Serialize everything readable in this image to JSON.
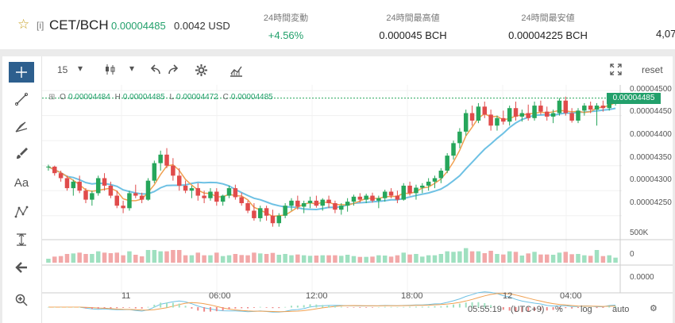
{
  "ticker": {
    "tag": "[i]",
    "pair": "CET/BCH",
    "price": "0.00004485",
    "usd": "0.0042 USD",
    "stats": [
      {
        "label": "24時間変動",
        "value": "+4.56%"
      },
      {
        "label": "24時間最高値",
        "value": "0.000045 BCH"
      },
      {
        "label": "24時間最安値",
        "value": "0.00004225 BCH"
      }
    ],
    "truncated": "4,07"
  },
  "toolbar": {
    "interval": "15",
    "reset": "reset"
  },
  "ohlc": {
    "o_label": "O",
    "o": "0.00004484",
    "h_label": "H",
    "h": "0.00004485",
    "l_label": "L",
    "l": "0.00004472",
    "c_label": "C",
    "c": "0.00004485"
  },
  "price_label": "0.00004485",
  "y_axis": [
    "0.00004500",
    "0.00004450",
    "0.00004400",
    "0.00004350",
    "0.00004300",
    "0.00004250"
  ],
  "volume_axis": [
    "500K",
    "0"
  ],
  "macd_axis": [
    "0.0000"
  ],
  "x_axis": [
    "11",
    "06:00",
    "12:00",
    "18:00",
    "12",
    "04:00"
  ],
  "bottom": {
    "time": "05:55:19",
    "tz": "(UTC+9)",
    "percent": "%",
    "log": "log",
    "auto": "auto"
  },
  "colors": {
    "up": "#26a65b",
    "down": "#e04b4b",
    "ma_fast": "#f0a050",
    "ma_slow": "#6ec1e4",
    "accent": "#2d5f8e"
  },
  "chart_data": {
    "type": "candlestick",
    "y_range": [
      4.21e-05,
      4.505e-05
    ],
    "candles": [
      [
        4347,
        4352,
        4340,
        4348
      ],
      [
        4348,
        4350,
        4330,
        4335
      ],
      [
        4335,
        4340,
        4318,
        4325
      ],
      [
        4325,
        4330,
        4300,
        4305
      ],
      [
        4305,
        4322,
        4290,
        4318
      ],
      [
        4318,
        4330,
        4295,
        4300
      ],
      [
        4300,
        4305,
        4275,
        4282
      ],
      [
        4282,
        4300,
        4270,
        4295
      ],
      [
        4295,
        4330,
        4290,
        4325
      ],
      [
        4325,
        4335,
        4300,
        4310
      ],
      [
        4310,
        4318,
        4285,
        4290
      ],
      [
        4290,
        4300,
        4265,
        4270
      ],
      [
        4270,
        4280,
        4255,
        4265
      ],
      [
        4265,
        4300,
        4260,
        4295
      ],
      [
        4295,
        4312,
        4285,
        4290
      ],
      [
        4290,
        4296,
        4275,
        4282
      ],
      [
        4282,
        4325,
        4280,
        4320
      ],
      [
        4320,
        4360,
        4315,
        4355
      ],
      [
        4355,
        4380,
        4340,
        4372
      ],
      [
        4372,
        4385,
        4345,
        4350
      ],
      [
        4350,
        4365,
        4320,
        4330
      ],
      [
        4330,
        4345,
        4300,
        4310
      ],
      [
        4310,
        4320,
        4295,
        4300
      ],
      [
        4300,
        4310,
        4285,
        4305
      ],
      [
        4305,
        4315,
        4280,
        4290
      ],
      [
        4290,
        4300,
        4275,
        4285
      ],
      [
        4285,
        4305,
        4280,
        4298
      ],
      [
        4298,
        4305,
        4270,
        4278
      ],
      [
        4278,
        4292,
        4270,
        4290
      ],
      [
        4290,
        4310,
        4285,
        4305
      ],
      [
        4305,
        4312,
        4282,
        4287
      ],
      [
        4287,
        4296,
        4270,
        4275
      ],
      [
        4275,
        4280,
        4255,
        4260
      ],
      [
        4260,
        4275,
        4240,
        4245
      ],
      [
        4245,
        4270,
        4238,
        4265
      ],
      [
        4265,
        4270,
        4240,
        4250
      ],
      [
        4250,
        4262,
        4228,
        4235
      ],
      [
        4235,
        4255,
        4228,
        4250
      ],
      [
        4250,
        4275,
        4245,
        4270
      ],
      [
        4270,
        4285,
        4260,
        4280
      ],
      [
        4280,
        4290,
        4262,
        4268
      ],
      [
        4268,
        4280,
        4255,
        4275
      ],
      [
        4275,
        4288,
        4265,
        4280
      ],
      [
        4280,
        4290,
        4266,
        4270
      ],
      [
        4270,
        4285,
        4260,
        4282
      ],
      [
        4282,
        4290,
        4265,
        4275
      ],
      [
        4275,
        4280,
        4255,
        4262
      ],
      [
        4262,
        4275,
        4252,
        4270
      ],
      [
        4270,
        4285,
        4258,
        4278
      ],
      [
        4278,
        4292,
        4270,
        4288
      ],
      [
        4288,
        4295,
        4276,
        4282
      ],
      [
        4282,
        4294,
        4275,
        4290
      ],
      [
        4290,
        4296,
        4276,
        4280
      ],
      [
        4280,
        4290,
        4265,
        4285
      ],
      [
        4285,
        4302,
        4278,
        4298
      ],
      [
        4298,
        4305,
        4285,
        4290
      ],
      [
        4290,
        4300,
        4275,
        4282
      ],
      [
        4282,
        4315,
        4280,
        4310
      ],
      [
        4310,
        4318,
        4290,
        4295
      ],
      [
        4295,
        4312,
        4282,
        4306
      ],
      [
        4306,
        4315,
        4295,
        4310
      ],
      [
        4310,
        4325,
        4300,
        4318
      ],
      [
        4318,
        4330,
        4305,
        4325
      ],
      [
        4325,
        4345,
        4315,
        4340
      ],
      [
        4340,
        4375,
        4335,
        4370
      ],
      [
        4370,
        4400,
        4362,
        4395
      ],
      [
        4395,
        4425,
        4385,
        4418
      ],
      [
        4418,
        4462,
        4410,
        4455
      ],
      [
        4455,
        4470,
        4430,
        4440
      ],
      [
        4440,
        4475,
        4435,
        4468
      ],
      [
        4468,
        4478,
        4445,
        4452
      ],
      [
        4452,
        4462,
        4420,
        4430
      ],
      [
        4430,
        4450,
        4420,
        4445
      ],
      [
        4445,
        4460,
        4432,
        4438
      ],
      [
        4438,
        4470,
        4430,
        4465
      ],
      [
        4465,
        4478,
        4440,
        4448
      ],
      [
        4448,
        4462,
        4438,
        4455
      ],
      [
        4455,
        4472,
        4440,
        4445
      ],
      [
        4445,
        4478,
        4440,
        4470
      ],
      [
        4470,
        4480,
        4452,
        4458
      ],
      [
        4458,
        4468,
        4440,
        4448
      ],
      [
        4448,
        4462,
        4435,
        4455
      ],
      [
        4455,
        4485,
        4450,
        4480
      ],
      [
        4480,
        4488,
        4450,
        4455
      ],
      [
        4455,
        4465,
        4436,
        4440
      ],
      [
        4440,
        4465,
        4435,
        4460
      ],
      [
        4460,
        4475,
        4450,
        4470
      ],
      [
        4470,
        4478,
        4455,
        4462
      ],
      [
        4462,
        4475,
        4430,
        4470
      ],
      [
        4470,
        4480,
        4458,
        4465
      ],
      [
        4465,
        4485,
        4460,
        4484
      ],
      [
        4484,
        4486,
        4470,
        4485
      ]
    ]
  }
}
